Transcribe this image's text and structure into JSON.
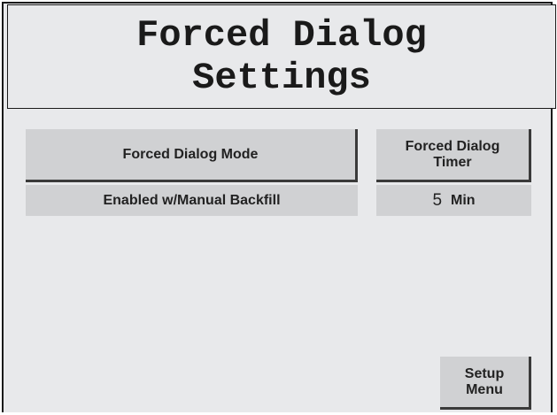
{
  "title": {
    "line1": "Forced Dialog",
    "line2": "Settings"
  },
  "mode": {
    "button_label": "Forced Dialog Mode",
    "value": "Enabled w/Manual Backfill"
  },
  "timer": {
    "button_line1": "Forced Dialog",
    "button_line2": "Timer",
    "value": "5",
    "unit": "Min"
  },
  "setup": {
    "line1": "Setup",
    "line2": "Menu"
  }
}
